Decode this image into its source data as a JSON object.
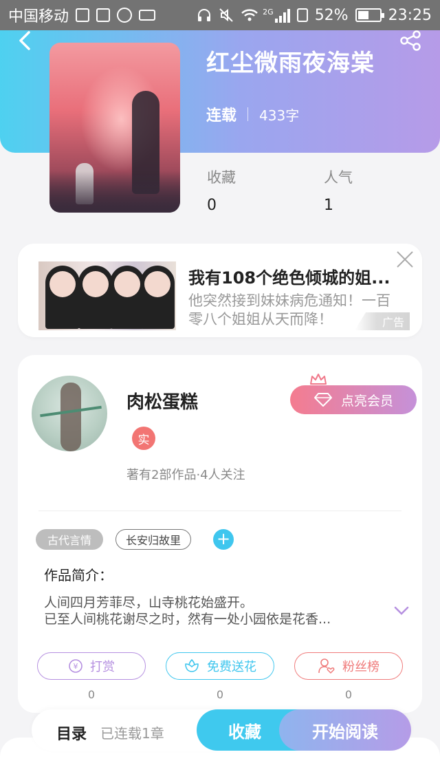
{
  "status_bar": {
    "carrier": "中国移动",
    "network": "2G",
    "battery": "52%",
    "battery_level": 0.52,
    "time": "23:25"
  },
  "book": {
    "title": "红尘微雨夜海棠",
    "status": "连载",
    "word_count": "433字",
    "stats": [
      {
        "label": "收藏",
        "value": "0"
      },
      {
        "label": "人气",
        "value": "1"
      }
    ]
  },
  "ad": {
    "title": "我有108个绝色倾城的姐...",
    "description": "他突然接到妹妹病危通知！一百零八个姐姐从天而降！",
    "tag": "广告"
  },
  "author": {
    "name": "肉松蛋糕",
    "badge": "实",
    "stats": "著有2部作品·4人关注",
    "vip_button": "点亮会员"
  },
  "tags": [
    "古代言情",
    "长安归故里"
  ],
  "intro": {
    "label": "作品简介：",
    "lines": [
      "人间四月芳菲尽，山寺桃花始盛开。",
      "已至人间桃花谢尽之时，然有一处小园依是花香..."
    ]
  },
  "actions": [
    {
      "label": "打赏",
      "count": "0",
      "color": "#b58fe0"
    },
    {
      "label": "免费送花",
      "count": "0",
      "color": "#3fc6ee"
    },
    {
      "label": "粉丝榜",
      "count": "0",
      "color": "#ef7a7a"
    }
  ],
  "bottom_bar": {
    "toc_label": "目录",
    "chapter_count": "已连载1章",
    "collect_button": "收藏",
    "read_button": "开始阅读"
  },
  "icons": {
    "back": "chevron-left-icon",
    "share": "share-icon",
    "close": "close-icon",
    "expand": "chevron-down-icon",
    "diamond": "diamond-icon",
    "crown": "crown-icon"
  }
}
